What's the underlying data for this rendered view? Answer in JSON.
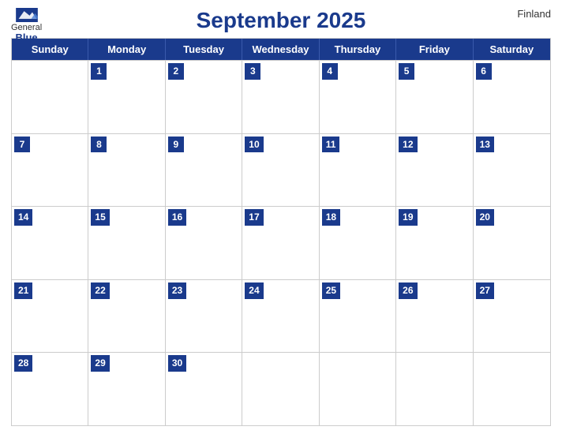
{
  "header": {
    "title": "September 2025",
    "country": "Finland",
    "logo_general": "General",
    "logo_blue": "Blue"
  },
  "days_of_week": [
    "Sunday",
    "Monday",
    "Tuesday",
    "Wednesday",
    "Thursday",
    "Friday",
    "Saturday"
  ],
  "weeks": [
    [
      {
        "num": "",
        "empty": true
      },
      {
        "num": "1",
        "empty": false
      },
      {
        "num": "2",
        "empty": false
      },
      {
        "num": "3",
        "empty": false
      },
      {
        "num": "4",
        "empty": false
      },
      {
        "num": "5",
        "empty": false
      },
      {
        "num": "6",
        "empty": false
      }
    ],
    [
      {
        "num": "7",
        "empty": false
      },
      {
        "num": "8",
        "empty": false
      },
      {
        "num": "9",
        "empty": false
      },
      {
        "num": "10",
        "empty": false
      },
      {
        "num": "11",
        "empty": false
      },
      {
        "num": "12",
        "empty": false
      },
      {
        "num": "13",
        "empty": false
      }
    ],
    [
      {
        "num": "14",
        "empty": false
      },
      {
        "num": "15",
        "empty": false
      },
      {
        "num": "16",
        "empty": false
      },
      {
        "num": "17",
        "empty": false
      },
      {
        "num": "18",
        "empty": false
      },
      {
        "num": "19",
        "empty": false
      },
      {
        "num": "20",
        "empty": false
      }
    ],
    [
      {
        "num": "21",
        "empty": false
      },
      {
        "num": "22",
        "empty": false
      },
      {
        "num": "23",
        "empty": false
      },
      {
        "num": "24",
        "empty": false
      },
      {
        "num": "25",
        "empty": false
      },
      {
        "num": "26",
        "empty": false
      },
      {
        "num": "27",
        "empty": false
      }
    ],
    [
      {
        "num": "28",
        "empty": false
      },
      {
        "num": "29",
        "empty": false
      },
      {
        "num": "30",
        "empty": false
      },
      {
        "num": "",
        "empty": true
      },
      {
        "num": "",
        "empty": true
      },
      {
        "num": "",
        "empty": true
      },
      {
        "num": "",
        "empty": true
      }
    ]
  ]
}
